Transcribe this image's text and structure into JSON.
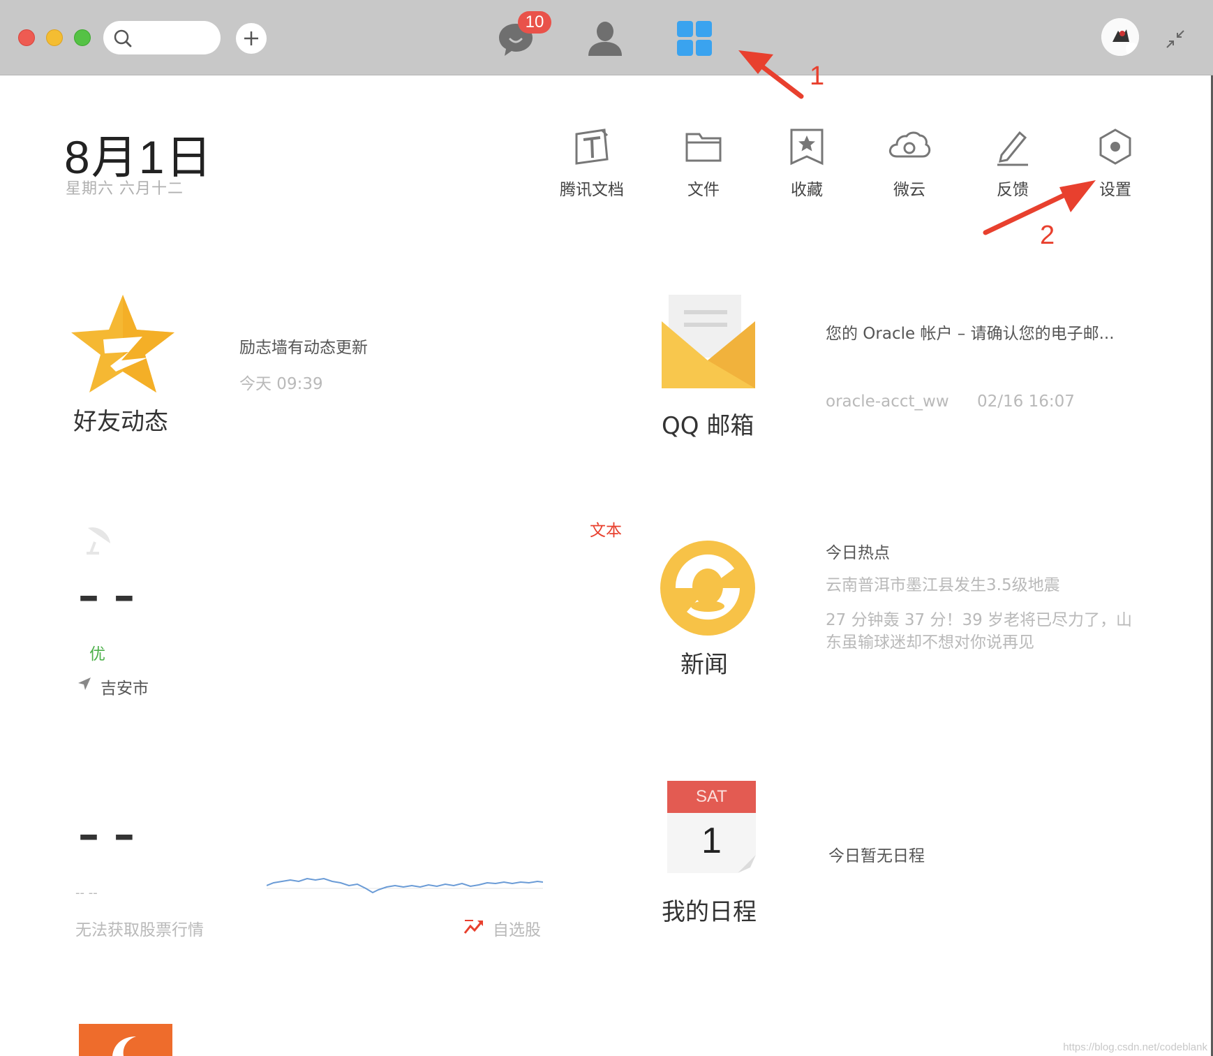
{
  "toolbar": {
    "badge_count": "10",
    "icons": [
      "chat-bubble-icon",
      "contact-person-icon",
      "apps-grid-icon"
    ]
  },
  "date": {
    "main": "8月1日",
    "sub": "星期六  六月十二"
  },
  "tools": [
    {
      "label": "腾讯文档",
      "icon": "tencent-docs-icon"
    },
    {
      "label": "文件",
      "icon": "folder-icon"
    },
    {
      "label": "收藏",
      "icon": "bookmark-star-icon"
    },
    {
      "label": "微云",
      "icon": "cloud-icon"
    },
    {
      "label": "反馈",
      "icon": "pencil-icon"
    },
    {
      "label": "设置",
      "icon": "gear-hexagon-icon"
    }
  ],
  "annotations": {
    "one": "1",
    "two": "2",
    "color": "#e8402e"
  },
  "friends": {
    "title": "好友动态",
    "update": "励志墙有动态更新",
    "time": "今天 09:39"
  },
  "mail": {
    "title": "QQ 邮箱",
    "subject": "您的 Oracle 帐户 – 请确认您的电子邮...",
    "sender": "oracle-acct_ww",
    "time": "02/16 16:07"
  },
  "weather": {
    "tag": "文本",
    "temp": "– –",
    "quality": "优",
    "city": "吉安市"
  },
  "news": {
    "title": "新闻",
    "heading": "今日热点",
    "item1": "云南普洱市墨江县发生3.5级地震",
    "item2_line1": "27 分钟轰 37 分！39 岁老将已尽力了，山",
    "item2_line2": "东虽输球迷却不想对你说再见"
  },
  "stock": {
    "value": "– –",
    "sub": "--   --",
    "message": "无法获取股票行情",
    "link": "自选股"
  },
  "schedule": {
    "title": "我的日程",
    "weekday": "SAT",
    "day": "1",
    "message": "今日暂无日程"
  },
  "watermark": "https://blog.csdn.net/codeblank"
}
